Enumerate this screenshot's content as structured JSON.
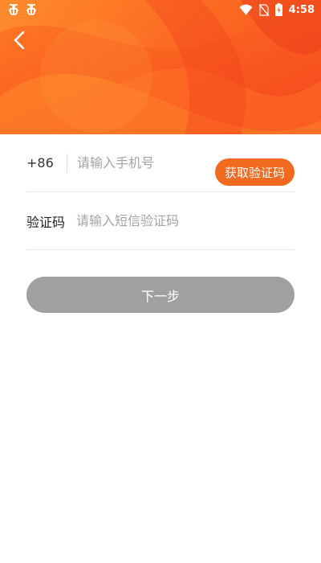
{
  "status_bar": {
    "left_icons": [
      "bug-icon",
      "bug-icon"
    ],
    "right_icons": [
      "wifi-icon",
      "no-sim-icon",
      "battery-charging-icon"
    ],
    "time": "4:58"
  },
  "header": {
    "back_icon": "chevron-left-icon",
    "colors": {
      "base": "#fb5a1e",
      "light": "#ff8a2a",
      "dark": "#f0401a"
    }
  },
  "form": {
    "phone": {
      "country_code": "+86",
      "placeholder": "请输入手机号",
      "value": ""
    },
    "get_code_label": "获取验证码",
    "code": {
      "label": "验证码",
      "placeholder": "请输入短信验证码",
      "value": ""
    }
  },
  "next_label": "下一步",
  "colors": {
    "accent": "#f26a1f",
    "button_disabled": "#a0a0a0"
  }
}
